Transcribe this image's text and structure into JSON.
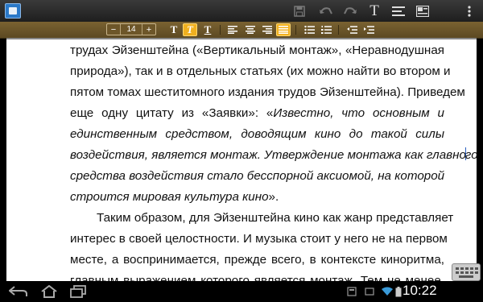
{
  "toolbar": {
    "font_size_value": "14",
    "minus_label": "−",
    "plus_label": "+",
    "bold_label": "T",
    "italic_label": "T",
    "underline_label": "T",
    "text_icon_label": "T"
  },
  "content": {
    "lines": [
      {
        "segments": [
          {
            "text": "трудах Эйзенштейна («Вертикальный монтаж», «Неравнодушная"
          }
        ]
      },
      {
        "segments": [
          {
            "text": "природа»), так и в отдельных статьях (их можно найти во втором и"
          }
        ]
      },
      {
        "segments": [
          {
            "text": "пятом томах шеститомного издания трудов Эйзенштейна). Приведем"
          }
        ]
      },
      {
        "segments": [
          {
            "text": "еще одну цитату из «Заявки»: «"
          },
          {
            "text": "Известно, что основным и",
            "italic": true
          }
        ]
      },
      {
        "segments": [
          {
            "text": "единственным средством, доводящим кино до такой силы",
            "italic": true
          }
        ]
      },
      {
        "segments": [
          {
            "text": "воздействия, является монтаж. Утверждение монтажа как главно",
            "italic": true
          },
          {
            "cursor": true
          },
          {
            "text": "го",
            "italic": true
          }
        ]
      },
      {
        "segments": [
          {
            "text": "средства воздействия стало бесспорной аксиомой, на которой",
            "italic": true
          }
        ]
      },
      {
        "segments": [
          {
            "text": "строится мировая культура кино",
            "italic": true
          },
          {
            "text": "»."
          }
        ],
        "last": true
      },
      {
        "segments": [
          {
            "text": "Таким образом, для Эйзенштейна кино как жанр представляет"
          }
        ],
        "indent": true
      },
      {
        "segments": [
          {
            "text": "интерес в своей целостности. И музыка стоит у него не на первом"
          }
        ]
      },
      {
        "segments": [
          {
            "text": "месте, а воспринимается, прежде всего, в контексте киноритма,"
          }
        ]
      },
      {
        "segments": [
          {
            "text": "главным выражением которого является монтаж. Тем не менее,"
          }
        ]
      }
    ]
  },
  "status_bar": {
    "time": "10:22"
  },
  "colors": {
    "format_bar": "#6d5629",
    "active_button": "#f0b020",
    "cursor": "#2a5fc0"
  },
  "icons": [
    "app-icon",
    "save-icon",
    "undo-icon",
    "redo-icon",
    "text-format-icon",
    "align-icon",
    "insert-image-icon",
    "overflow-menu-icon",
    "back-icon",
    "home-icon",
    "recent-apps-icon",
    "keyboard-icon",
    "usb-icon",
    "wifi-icon",
    "battery-icon"
  ]
}
